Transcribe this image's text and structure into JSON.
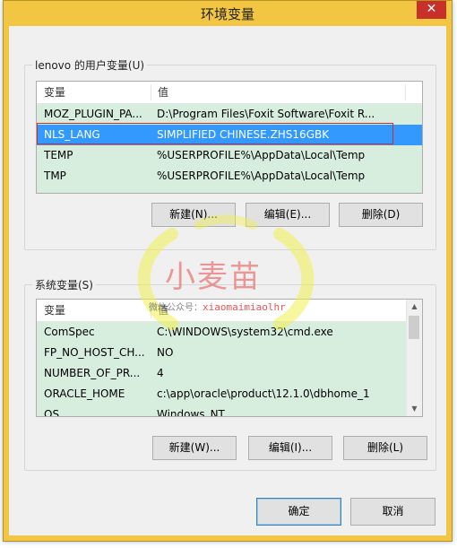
{
  "window": {
    "title": "环境变量",
    "close_glyph": "✕"
  },
  "user_vars": {
    "group_label": "lenovo 的用户变量(U)",
    "col_var": "变量",
    "col_val": "值",
    "rows": [
      {
        "name": "MOZ_PLUGIN_PA...",
        "value": "D:\\Program Files\\Foxit Software\\Foxit R..."
      },
      {
        "name": "NLS_LANG",
        "value": "SIMPLIFIED CHINESE.ZHS16GBK"
      },
      {
        "name": "TEMP",
        "value": "%USERPROFILE%\\AppData\\Local\\Temp"
      },
      {
        "name": "TMP",
        "value": "%USERPROFILE%\\AppData\\Local\\Temp"
      }
    ],
    "selected_index": 1,
    "buttons": {
      "new": "新建(N)...",
      "edit": "编辑(E)...",
      "delete": "删除(D)"
    }
  },
  "system_vars": {
    "group_label": "系统变量(S)",
    "col_var": "变量",
    "col_val": "值",
    "rows": [
      {
        "name": "ComSpec",
        "value": "C:\\WINDOWS\\system32\\cmd.exe"
      },
      {
        "name": "FP_NO_HOST_CH...",
        "value": "NO"
      },
      {
        "name": "NUMBER_OF_PR...",
        "value": "4"
      },
      {
        "name": "ORACLE_HOME",
        "value": "c:\\app\\oracle\\product\\12.1.0\\dbhome_1"
      },
      {
        "name": "OS",
        "value": "Windows_NT"
      }
    ],
    "scroll_up": "▲",
    "scroll_down": "▼",
    "buttons": {
      "new": "新建(W)...",
      "edit": "编辑(I)...",
      "delete": "删除(L)"
    }
  },
  "footer": {
    "ok": "确定",
    "cancel": "取消"
  },
  "watermark": {
    "main": "小麦苗",
    "sub_label": "微信公众号：",
    "account": "xiaomaimiaolhr"
  },
  "colors": {
    "selection": "#3399ff",
    "row_tint": "#d7eede",
    "window_frame": "#f2c542",
    "highlight_box": "#d22b2b"
  }
}
